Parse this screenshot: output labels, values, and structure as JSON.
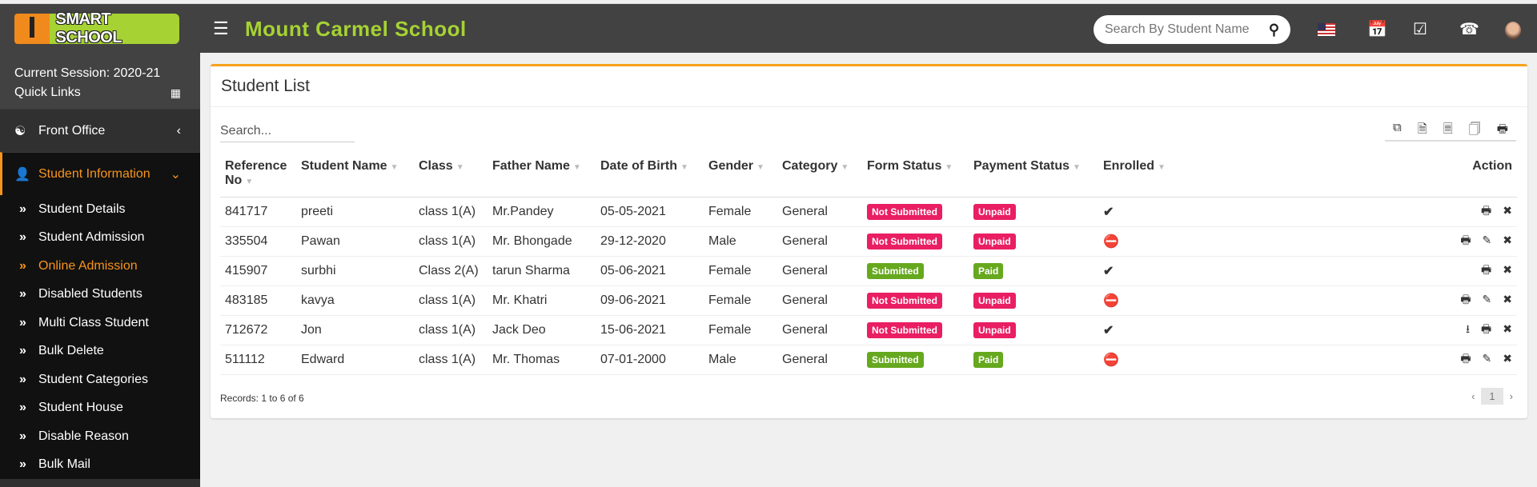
{
  "header": {
    "logo_text": "SMART SCHOOL",
    "school_name": "Mount Carmel School",
    "search_placeholder": "Search By Student Name",
    "icons": [
      "flag-us-icon",
      "calendar-icon",
      "task-check-icon",
      "whatsapp-icon",
      "avatar"
    ]
  },
  "sidebar": {
    "session": "Current Session: 2020-21",
    "quick_links": "Quick Links",
    "items": [
      {
        "label": "Front Office"
      },
      {
        "label": "Student Information"
      }
    ],
    "subitems": [
      {
        "label": "Student Details"
      },
      {
        "label": "Student Admission"
      },
      {
        "label": "Online Admission"
      },
      {
        "label": "Disabled Students"
      },
      {
        "label": "Multi Class Student"
      },
      {
        "label": "Bulk Delete"
      },
      {
        "label": "Student Categories"
      },
      {
        "label": "Student House"
      },
      {
        "label": "Disable Reason"
      },
      {
        "label": "Bulk Mail"
      }
    ]
  },
  "main": {
    "title": "Student List",
    "search_placeholder": "Search...",
    "columns": [
      "Reference No",
      "Student Name",
      "Class",
      "Father Name",
      "Date of Birth",
      "Gender",
      "Category",
      "Form Status",
      "Payment Status",
      "Enrolled",
      "Action"
    ],
    "rows": [
      {
        "ref": "841717",
        "name": "preeti",
        "class": "class 1(A)",
        "father": "Mr.Pandey",
        "dob": "05-05-2021",
        "gender": "Female",
        "category": "General",
        "form": "Not Submitted",
        "payment": "Unpaid",
        "enrolled": "yes",
        "actions": [
          "print",
          "delete"
        ]
      },
      {
        "ref": "335504",
        "name": "Pawan",
        "class": "class 1(A)",
        "father": "Mr. Bhongade",
        "dob": "29-12-2020",
        "gender": "Male",
        "category": "General",
        "form": "Not Submitted",
        "payment": "Unpaid",
        "enrolled": "no",
        "actions": [
          "print",
          "edit",
          "delete"
        ]
      },
      {
        "ref": "415907",
        "name": "surbhi",
        "class": "Class 2(A)",
        "father": "tarun Sharma",
        "dob": "05-06-2021",
        "gender": "Female",
        "category": "General",
        "form": "Submitted",
        "payment": "Paid",
        "enrolled": "yes",
        "actions": [
          "print",
          "delete"
        ]
      },
      {
        "ref": "483185",
        "name": "kavya",
        "class": "class 1(A)",
        "father": "Mr. Khatri",
        "dob": "09-06-2021",
        "gender": "Female",
        "category": "General",
        "form": "Not Submitted",
        "payment": "Unpaid",
        "enrolled": "no",
        "actions": [
          "print",
          "edit",
          "delete"
        ]
      },
      {
        "ref": "712672",
        "name": "Jon",
        "class": "class 1(A)",
        "father": "Jack Deo",
        "dob": "15-06-2021",
        "gender": "Female",
        "category": "General",
        "form": "Not Submitted",
        "payment": "Unpaid",
        "enrolled": "yes",
        "actions": [
          "download",
          "print",
          "delete"
        ]
      },
      {
        "ref": "511112",
        "name": "Edward",
        "class": "class 1(A)",
        "father": "Mr. Thomas",
        "dob": "07-01-2000",
        "gender": "Male",
        "category": "General",
        "form": "Submitted",
        "payment": "Paid",
        "enrolled": "no",
        "actions": [
          "print",
          "edit",
          "delete"
        ]
      }
    ],
    "records": "Records: 1 to 6 of 6",
    "page": "1"
  },
  "colors": {
    "accent": "#f7941d",
    "brand_green": "#a6d233",
    "danger": "#e91e63",
    "success": "#66a81e"
  }
}
